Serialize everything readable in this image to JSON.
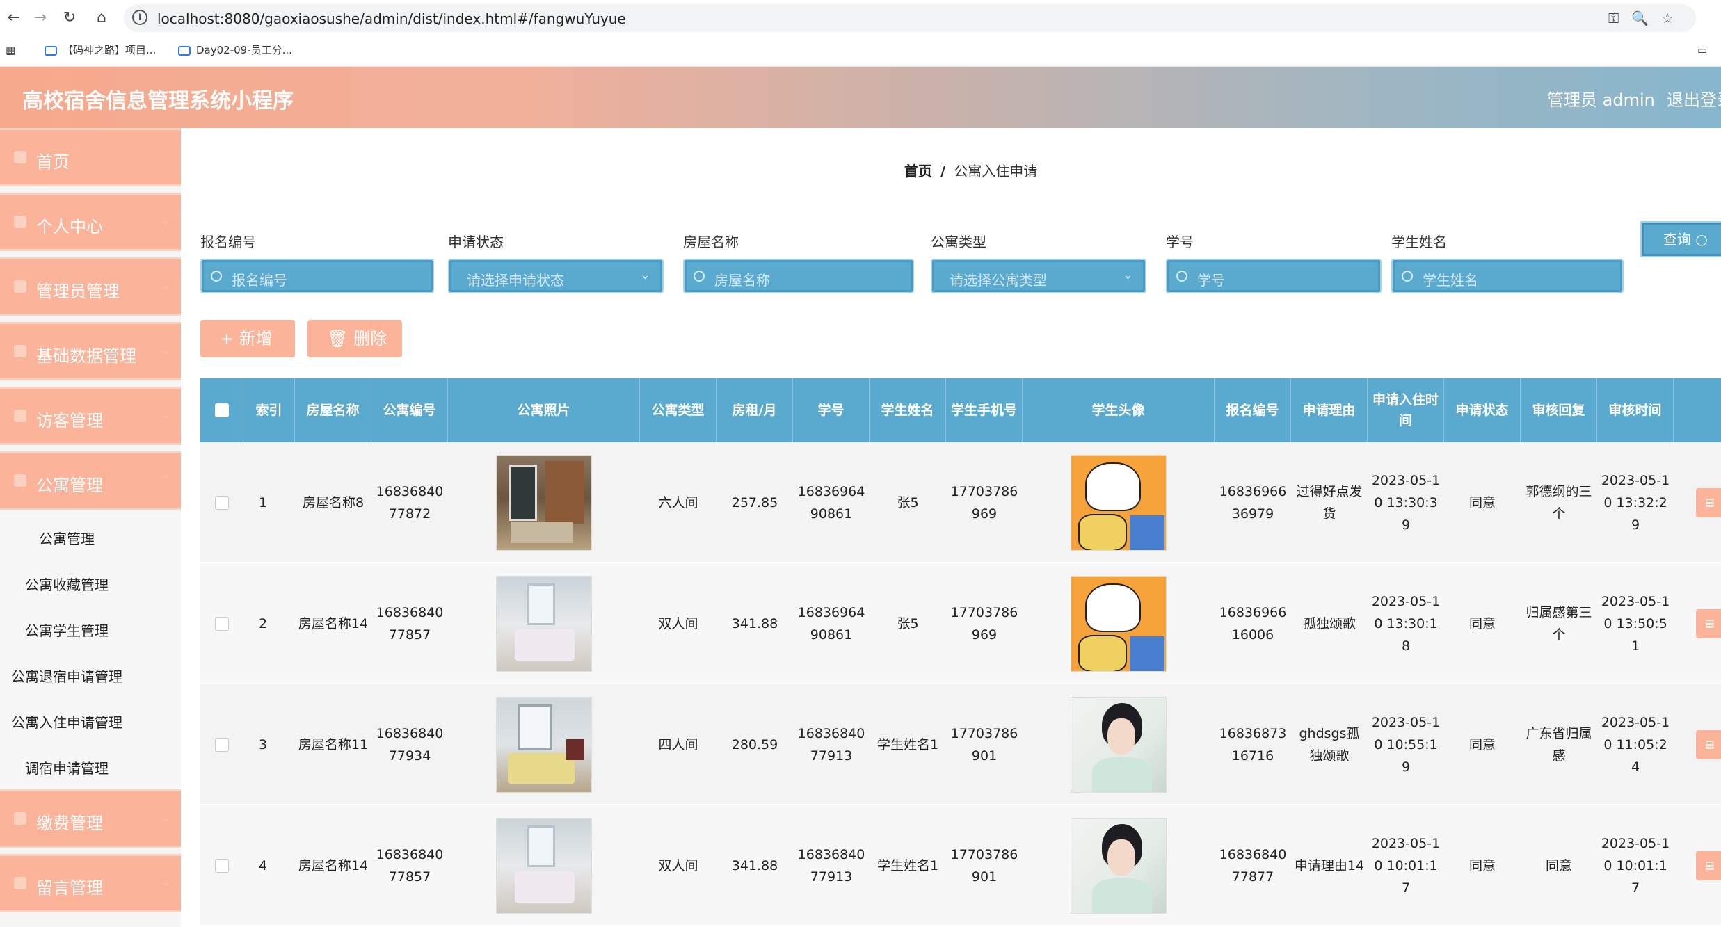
{
  "browser": {
    "url": "localhost:8080/gaoxiaosushe/admin/dist/index.html#/fangwuYuyue",
    "bookmarks": [
      "【码神之路】项目...",
      "Day02-09-员工分..."
    ]
  },
  "header": {
    "title": "高校宿舍信息管理系统小程序",
    "user": "管理员 admin",
    "logout": "退出登录"
  },
  "sidebar": {
    "items": [
      {
        "label": "首页"
      },
      {
        "label": "个人中心"
      },
      {
        "label": "管理员管理"
      },
      {
        "label": "基础数据管理"
      },
      {
        "label": "访客管理"
      },
      {
        "label": "公寓管理"
      }
    ],
    "submenu": [
      "公寓管理",
      "公寓收藏管理",
      "公寓学生管理",
      "公寓退宿申请管理",
      "公寓入住申请管理",
      "调宿申请管理"
    ],
    "items_after": [
      {
        "label": "缴费管理"
      },
      {
        "label": "留言管理"
      }
    ]
  },
  "breadcrumb": {
    "home": "首页",
    "separator": "/",
    "current": "公寓入住申请"
  },
  "filters": [
    {
      "label": "报名编号",
      "placeholder": "报名编号",
      "type": "input"
    },
    {
      "label": "申请状态",
      "placeholder": "请选择申请状态",
      "type": "select"
    },
    {
      "label": "房屋名称",
      "placeholder": "房屋名称",
      "type": "input"
    },
    {
      "label": "公寓类型",
      "placeholder": "请选择公寓类型",
      "type": "select"
    },
    {
      "label": "学号",
      "placeholder": "学号",
      "type": "input"
    },
    {
      "label": "学生姓名",
      "placeholder": "学生姓名",
      "type": "input"
    }
  ],
  "buttons": {
    "query": "查询",
    "add": "+ 新增",
    "delete": "删除"
  },
  "table": {
    "headers": [
      "索引",
      "房屋名称",
      "公寓编号",
      "公寓照片",
      "公寓类型",
      "房租/月",
      "学号",
      "学生姓名",
      "学生手机号",
      "学生头像",
      "报名编号",
      "申请理由",
      "申请入住时间",
      "申请状态",
      "审核回复",
      "审核时间"
    ],
    "rows": [
      {
        "index": "1",
        "house": "房屋名称8",
        "apt_no": "1683684077872",
        "type": "六人间",
        "rent": "257.85",
        "student_no": "1683696490861",
        "name": "张5",
        "phone": "17703786969",
        "reg_no": "1683696636979",
        "reason": "过得好点发货",
        "apply_time": "2023-05-10 13:30:39",
        "status": "同意",
        "reply": "郭德纲的三个",
        "review_time": "2023-05-10 13:32:29",
        "avatar": "cartoon"
      },
      {
        "index": "2",
        "house": "房屋名称14",
        "apt_no": "1683684077857",
        "type": "双人间",
        "rent": "341.88",
        "student_no": "1683696490861",
        "name": "张5",
        "phone": "17703786969",
        "reg_no": "1683696616006",
        "reason": "孤独颂歌",
        "apply_time": "2023-05-10 13:30:18",
        "status": "同意",
        "reply": "归属感第三个",
        "review_time": "2023-05-10 13:50:51",
        "avatar": "cartoon"
      },
      {
        "index": "3",
        "house": "房屋名称11",
        "apt_no": "1683684077934",
        "type": "四人间",
        "rent": "280.59",
        "student_no": "1683684077913",
        "name": "学生姓名1",
        "phone": "17703786901",
        "reg_no": "1683687316716",
        "reason": "ghdsgs孤独颂歌",
        "apply_time": "2023-05-10 10:55:19",
        "status": "同意",
        "reply": "广东省归属感",
        "review_time": "2023-05-10 11:05:24",
        "avatar": "portrait"
      },
      {
        "index": "4",
        "house": "房屋名称14",
        "apt_no": "1683684077857",
        "type": "双人间",
        "rent": "341.88",
        "student_no": "1683684077913",
        "name": "学生姓名1",
        "phone": "17703786901",
        "reg_no": "1683684077877",
        "reason": "申请理由14",
        "apply_time": "2023-05-10 10:01:17",
        "status": "同意",
        "reply": "同意",
        "review_time": "2023-05-10 10:01:17",
        "avatar": "portrait"
      }
    ]
  },
  "colors": {
    "accent": "#5aa9cf",
    "salmon": "#fbb49a"
  }
}
